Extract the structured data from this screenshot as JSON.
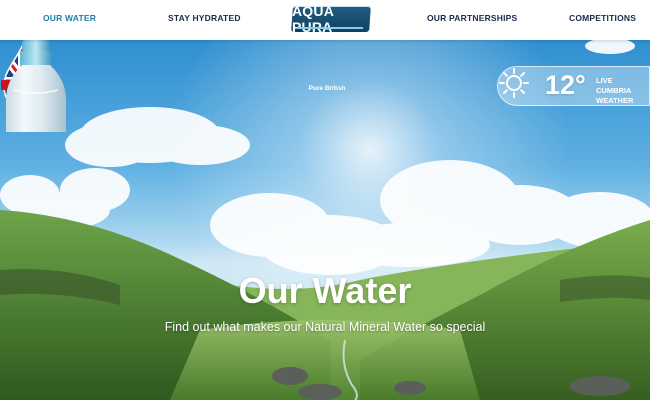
{
  "nav": {
    "items": [
      {
        "label": "OUR WATER",
        "active": true
      },
      {
        "label": "STAY HYDRATED",
        "active": false
      },
      {
        "label": "OUR PARTNERSHIPS",
        "active": false
      },
      {
        "label": "COMPETITIONS",
        "active": false
      }
    ],
    "logo_text": "AQUA PURA"
  },
  "badge": {
    "text": "Pure British",
    "icon": "union-jack-droplet-icon"
  },
  "weather": {
    "temperature": "12°",
    "label": "LIVE CUMBRIA WEATHER",
    "icon": "sun-icon"
  },
  "hero": {
    "title": "Our Water",
    "subtitle": "Find out what makes our Natural Mineral Water so special"
  },
  "colors": {
    "nav_text": "#1a2a4a",
    "nav_active": "#1d7ea8",
    "logo_bg": "#1f5f86",
    "sky": "#2f8fd0",
    "hills": "#5f9b3a"
  }
}
